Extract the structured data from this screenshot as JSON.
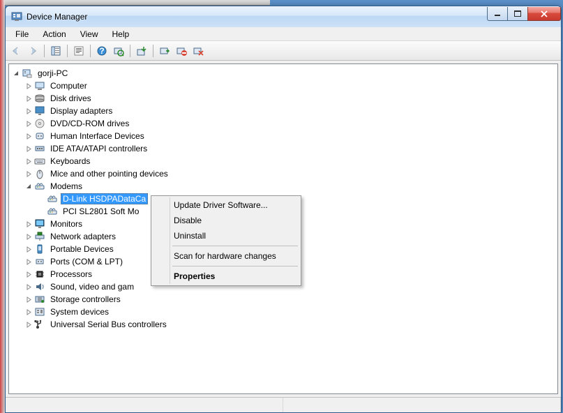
{
  "window": {
    "title": "Device Manager"
  },
  "menubar": {
    "items": [
      "File",
      "Action",
      "View",
      "Help"
    ]
  },
  "tree": {
    "root": {
      "label": "gorji-PC",
      "expanded": true,
      "children": [
        {
          "label": "Computer",
          "icon": "computer",
          "expanded": false
        },
        {
          "label": "Disk drives",
          "icon": "disk",
          "expanded": false
        },
        {
          "label": "Display adapters",
          "icon": "display",
          "expanded": false
        },
        {
          "label": "DVD/CD-ROM drives",
          "icon": "dvd",
          "expanded": false
        },
        {
          "label": "Human Interface Devices",
          "icon": "hid",
          "expanded": false
        },
        {
          "label": "IDE ATA/ATAPI controllers",
          "icon": "ide",
          "expanded": false
        },
        {
          "label": "Keyboards",
          "icon": "keyboard",
          "expanded": false
        },
        {
          "label": "Mice and other pointing devices",
          "icon": "mouse",
          "expanded": false
        },
        {
          "label": "Modems",
          "icon": "modem",
          "expanded": true,
          "children": [
            {
              "label": "D-Link HSDPADataCa",
              "icon": "modem",
              "selected": true
            },
            {
              "label": "PCI SL2801 Soft Mo",
              "icon": "modem"
            }
          ]
        },
        {
          "label": "Monitors",
          "icon": "monitor",
          "expanded": false
        },
        {
          "label": "Network adapters",
          "icon": "network",
          "expanded": false
        },
        {
          "label": "Portable Devices",
          "icon": "portable",
          "expanded": false
        },
        {
          "label": "Ports (COM & LPT)",
          "icon": "port",
          "expanded": false
        },
        {
          "label": "Processors",
          "icon": "processor",
          "expanded": false
        },
        {
          "label": "Sound, video and gam",
          "icon": "sound",
          "expanded": false,
          "truncated": true
        },
        {
          "label": "Storage controllers",
          "icon": "storage",
          "expanded": false
        },
        {
          "label": "System devices",
          "icon": "system",
          "expanded": false
        },
        {
          "label": "Universal Serial Bus controllers",
          "icon": "usb",
          "expanded": false
        }
      ]
    }
  },
  "context_menu": {
    "items": [
      {
        "label": "Update Driver Software...",
        "bold": false
      },
      {
        "label": "Disable",
        "bold": false
      },
      {
        "label": "Uninstall",
        "bold": false
      },
      {
        "sep": true
      },
      {
        "label": "Scan for hardware changes",
        "bold": false
      },
      {
        "sep": true
      },
      {
        "label": "Properties",
        "bold": true
      }
    ]
  }
}
